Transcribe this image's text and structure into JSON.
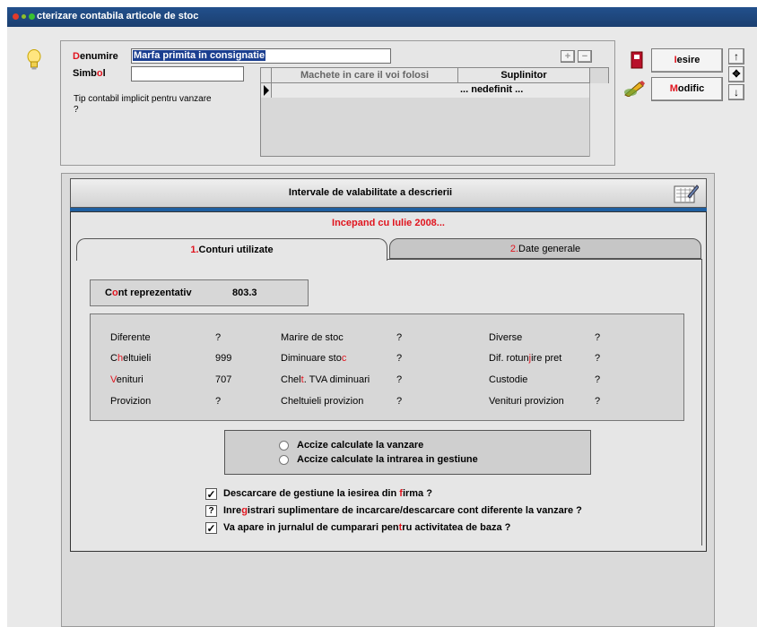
{
  "window": {
    "title": "cterizare contabila articole de stoc"
  },
  "header": {
    "denumire_label_first": "D",
    "denumire_label_rest": "enumire",
    "denumire_value": "Marfa primita in consignatie",
    "simbol_label_a": "Simb",
    "simbol_label_hot": "o",
    "simbol_label_b": "l",
    "simbol_value": "",
    "tip_contabil_label": "Tip contabil implicit pentru vanzare",
    "tip_contabil_value": "?",
    "grid": {
      "columns": [
        "Machete in care il voi folosi",
        "Suplinitor"
      ],
      "row": {
        "machete": "",
        "suplinitor": "... nedefinit ..."
      }
    }
  },
  "toolbar": {
    "iesire_hot": "I",
    "iesire_rest": "esire",
    "modific_hot": "M",
    "modific_rest": "odific"
  },
  "intervals": {
    "title": "Intervale de valabilitate a descrierii",
    "period": "Incepand cu Iulie 2008..."
  },
  "tabs": [
    {
      "num": "1.",
      "label": "Conturi utilizate",
      "active": true
    },
    {
      "num": "2.",
      "label": "Date generale",
      "active": false
    }
  ],
  "cont_reprezentativ": {
    "label_a": "C",
    "label_hot": "o",
    "label_b": "nt reprezentativ",
    "value": "803.3"
  },
  "accounts": [
    {
      "label": "Diferente",
      "value": "?"
    },
    {
      "label": "Marire de stoc",
      "value": "?"
    },
    {
      "label": "Diverse",
      "value": "?"
    },
    {
      "label_a": "C",
      "label_hot": "h",
      "label_b": "eltuieli",
      "value": "999"
    },
    {
      "label_a": "Diminuare sto",
      "label_hot": "c",
      "label_b": "",
      "value": "?"
    },
    {
      "label_a": "Dif. rotun",
      "label_hot": "j",
      "label_b": "ire pret",
      "value": "?"
    },
    {
      "label_a": "",
      "label_hot": "V",
      "label_b": "enituri",
      "value": "707"
    },
    {
      "label_a": "Chel",
      "label_hot": "t",
      "label_b": ". TVA diminuari",
      "value": "?"
    },
    {
      "label": "Custodie",
      "value": "?"
    },
    {
      "label": "Provizion",
      "value": "?"
    },
    {
      "label": "Cheltuieli provizion",
      "value": "?"
    },
    {
      "label": "Venituri provizion",
      "value": "?"
    }
  ],
  "accize": {
    "option_1": "Accize calculate la vanzare",
    "option_2": "Accize calculate la intrarea in gestiune"
  },
  "checks": [
    {
      "state": "✓",
      "a": "Descarcare de gestiune la iesirea din ",
      "hot": "f",
      "b": "irma ?"
    },
    {
      "state": "?",
      "a": "Inre",
      "hot": "g",
      "b": "istrari suplimentare de incarcare/descarcare cont diferente la vanzare ?"
    },
    {
      "state": "✓",
      "a": "Va apare in jurnalul de cumparari pen",
      "hot": "t",
      "b": "ru activitatea de baza ?"
    }
  ],
  "colors": {
    "titlebar": "#1b3f70",
    "accent_red": "#e0141e",
    "selection": "#1b3f90"
  }
}
